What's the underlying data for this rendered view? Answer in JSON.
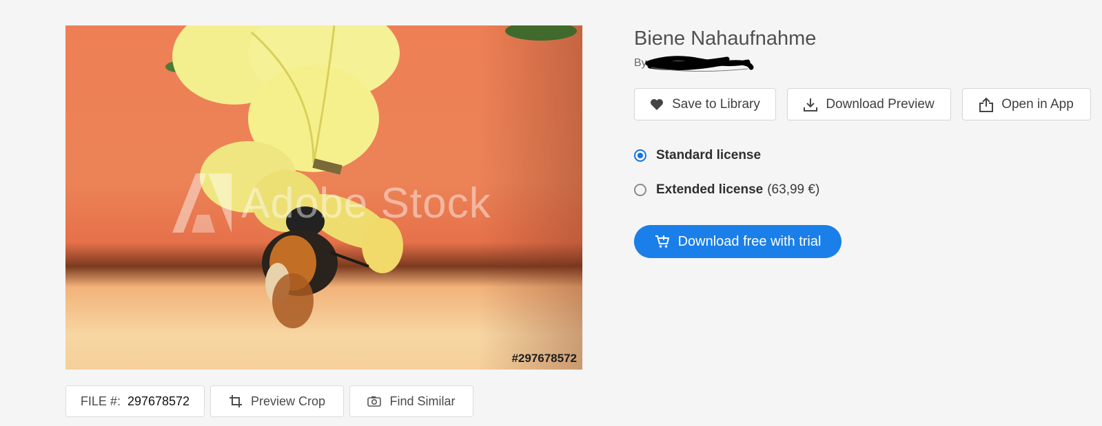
{
  "image": {
    "watermark_text": "Adobe Stock",
    "file_overlay": "#297678572",
    "alt_subject": "bee-on-yellow-flower"
  },
  "below_image": {
    "file_label": "FILE #:",
    "file_number": "297678572",
    "preview_crop_label": "Preview Crop",
    "find_similar_label": "Find Similar"
  },
  "details": {
    "title": "Biene Nahaufnahme",
    "by_prefix": "By"
  },
  "actions": {
    "save_label": "Save to Library",
    "download_preview_label": "Download Preview",
    "open_in_app_label": "Open in App"
  },
  "licenses": [
    {
      "name": "Standard license",
      "price": "",
      "selected": true
    },
    {
      "name": "Extended license",
      "price": "(63,99 €)",
      "selected": false
    }
  ],
  "cta": {
    "label": "Download free with trial"
  },
  "colors": {
    "accent": "#1473e6",
    "cta": "#1a7fe8",
    "background": "#f5f5f5"
  },
  "icons": {
    "save": "heart-icon",
    "download": "download-icon",
    "open": "share-icon",
    "crop": "crop-icon",
    "camera": "camera-icon",
    "cart": "cart-icon"
  }
}
